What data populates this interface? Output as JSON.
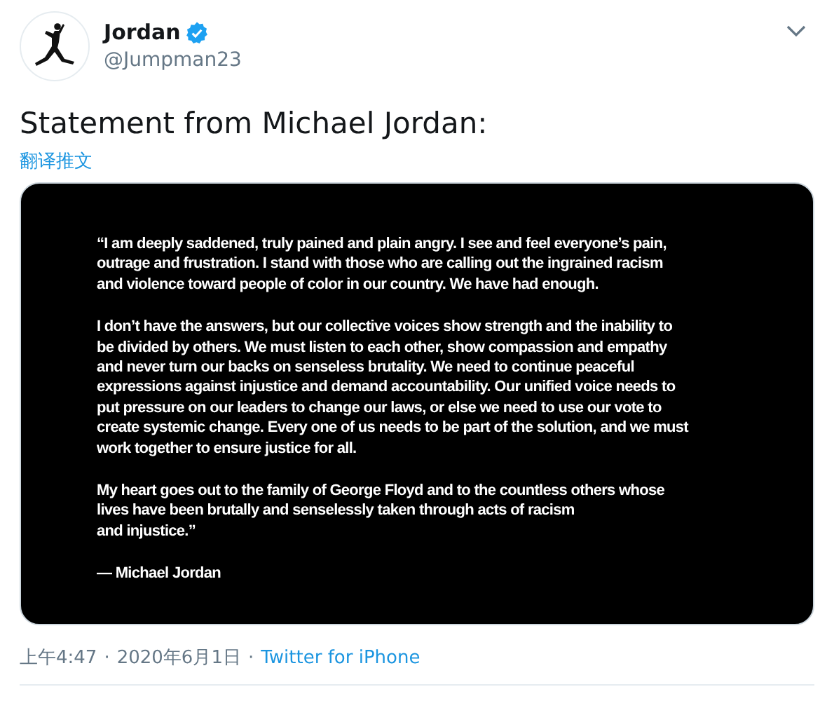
{
  "author": {
    "name": "Jordan",
    "verified": true,
    "handle": "@Jumpman23"
  },
  "tweet_text": "Statement from Michael Jordan:",
  "translate_link": "翻译推文",
  "statement_image": {
    "paragraphs": [
      [
        "“I am deeply saddened, truly pained and plain angry. I see and feel everyone’s pain,",
        "outrage and frustration. I stand with those who are calling out the ingrained racism",
        "and violence toward people of color in our country. We have had enough."
      ],
      [
        "I don’t have the answers, but our collective voices show strength and the inability to",
        "be divided by others. We must listen to each other, show compassion and empathy",
        "and never turn our backs on senseless brutality. We need to continue peaceful",
        "expressions against injustice and demand accountability. Our unified voice needs to",
        "put pressure on our leaders to change our laws, or else we need to use our vote to",
        "create systemic change. Every one of us needs to be part of the solution, and we must",
        "work together to ensure justice for all."
      ],
      [
        "My heart goes out to the family of George Floyd and to the countless others whose",
        "lives have been brutally and senselessly taken through acts of racism",
        "and injustice.”"
      ],
      [
        "— Michael Jordan"
      ]
    ]
  },
  "footer": {
    "time": "上午4:47",
    "date": "2020年6月1日",
    "separator": "·",
    "source": "Twitter for iPhone"
  }
}
